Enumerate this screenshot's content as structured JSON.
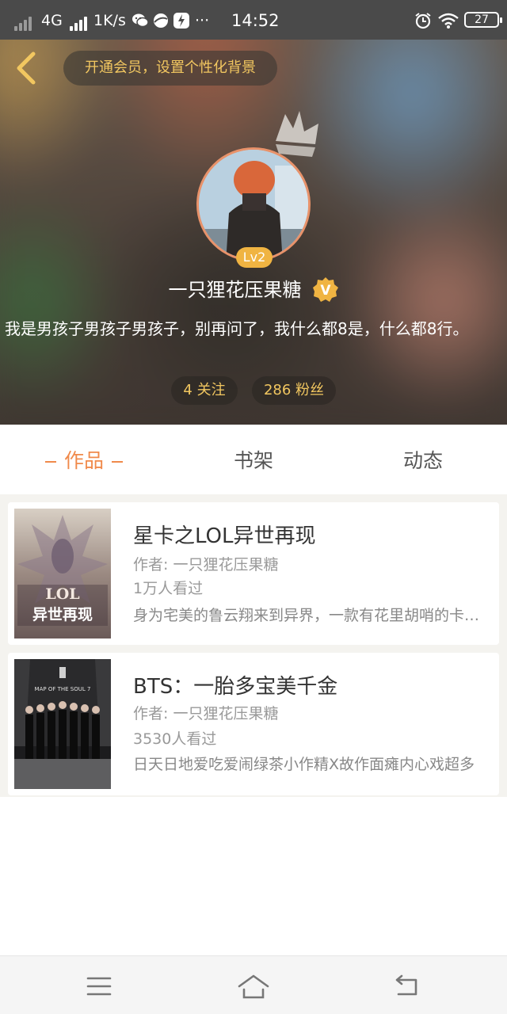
{
  "status_bar": {
    "network": "4G",
    "speed": "1K/s",
    "more": "···",
    "time": "14:52",
    "battery": "27",
    "icons": [
      "signal-icon",
      "wechat-icon",
      "browser-icon",
      "bolt-icon",
      "alarm-icon",
      "wifi-icon",
      "battery-icon"
    ]
  },
  "header": {
    "vip_prompt": "开通会员，设置个性化背景",
    "level": "Lv2",
    "username": "一只狸花压果糖",
    "verified_badge": "V",
    "bio": "我是男孩子男孩子男孩子，别再问了，我什么都8是，什么都8行。",
    "following": "4 关注",
    "followers": "286 粉丝"
  },
  "tabs": [
    {
      "label": "作品",
      "active": true
    },
    {
      "label": "书架",
      "active": false
    },
    {
      "label": "动态",
      "active": false
    }
  ],
  "works": [
    {
      "title": "星卡之LOL异世再现",
      "author": "作者: 一只狸花压果糖",
      "views": "1万人看过",
      "desc": "身为宅美的鲁云翔来到异界，一款有花里胡哨的卡牌游戏",
      "cover_text": "星卡LOL异世再现"
    },
    {
      "title": "BTS：一胎多宝美千金",
      "author": "作者: 一只狸花压果糖",
      "views": "3530人看过",
      "desc": "日天日地爱吃爱闹绿茶小作精X故作面瘫内心戏超多",
      "cover_text": "MAP OF THE SOUL 7"
    }
  ],
  "nav": {
    "icons": [
      "menu-icon",
      "home-icon",
      "back-icon"
    ]
  },
  "colors": {
    "accent": "#f08a4b",
    "gold": "#f2c760",
    "level_badge": "#f0b442"
  }
}
